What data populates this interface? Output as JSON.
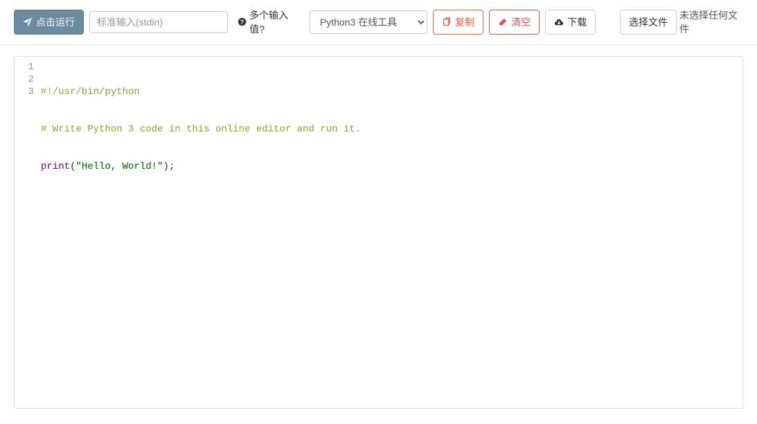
{
  "toolbar": {
    "run_label": "点击运行",
    "stdin_placeholder": "标准输入(stdin)",
    "multi_input_label": "多个输入值?",
    "language_selected": "Python3 在线工具",
    "copy_label": "复制",
    "clear_label": "清空",
    "download_label": "下载",
    "choose_file_label": "选择文件",
    "no_file_label": "未选择任何文件"
  },
  "code": {
    "lines": [
      "1",
      "2",
      "3"
    ],
    "line1": "#!/usr/bin/python",
    "line2": "# Write Python 3 code in this online editor and run it.",
    "line3_print": "print",
    "line3_open": "(",
    "line3_str": "\"Hello, World!\"",
    "line3_close": ")",
    "line3_semi": ";"
  }
}
